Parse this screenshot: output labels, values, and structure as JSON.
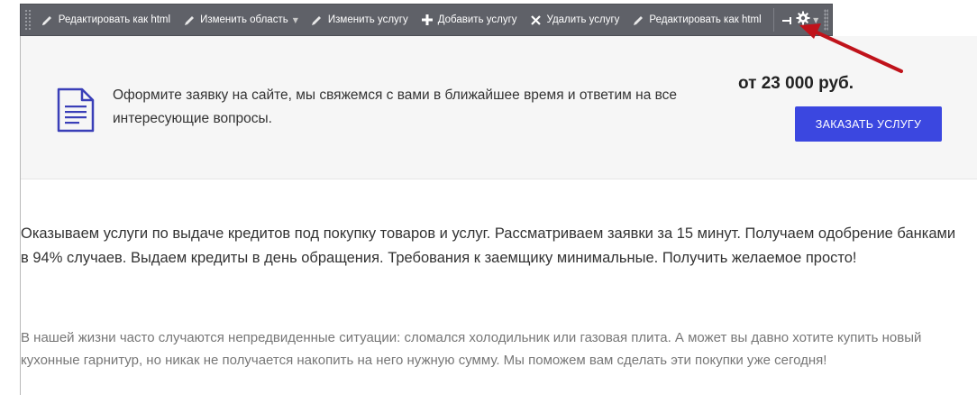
{
  "toolbar": {
    "buttons": [
      {
        "label": "Редактировать как html",
        "icon": "pencil-icon"
      },
      {
        "label": "Изменить область",
        "icon": "pencil-icon",
        "dropdown": true
      },
      {
        "label": "Изменить услугу",
        "icon": "pencil-icon"
      },
      {
        "label": "Добавить услугу",
        "icon": "plus-icon"
      },
      {
        "label": "Удалить услугу",
        "icon": "close-icon"
      },
      {
        "label": "Редактировать как html",
        "icon": "pencil-icon"
      }
    ],
    "extra_icons": [
      "pin-icon",
      "gear-icon",
      "grip-icon"
    ]
  },
  "banner": {
    "text": "Оформите заявку на сайте, мы свяжемся с вами в ближайшее время и ответим на все интересующие вопросы.",
    "price": "от 23 000 руб.",
    "order_button": "ЗАКАЗАТЬ УСЛУГУ",
    "icon": "document-icon"
  },
  "content": {
    "paragraph_1": "Оказываем услуги по выдаче кредитов под покупку товаров и услуг. Рассматриваем заявки за 15 минут. Получаем одобрение банками в 94% случаев. Выдаем кредиты в день обращения. Требования к заемщику минимальные. Получить желаемое просто!",
    "paragraph_2": "В нашей жизни часто случаются непредвиденные ситуации: сломался холодильник или газовая плита. А может вы давно хотите купить новый кухонные гарнитур, но никак не получается накопить на него нужную сумму. Мы поможем вам сделать эти покупки уже сегодня!"
  },
  "colors": {
    "toolbar_bg": "#5f6168",
    "banner_bg": "#f6f6f6",
    "button_accent": "#3b47e0",
    "annotation_arrow": "#c0131b",
    "doc_icon": "#3a3fb8"
  }
}
